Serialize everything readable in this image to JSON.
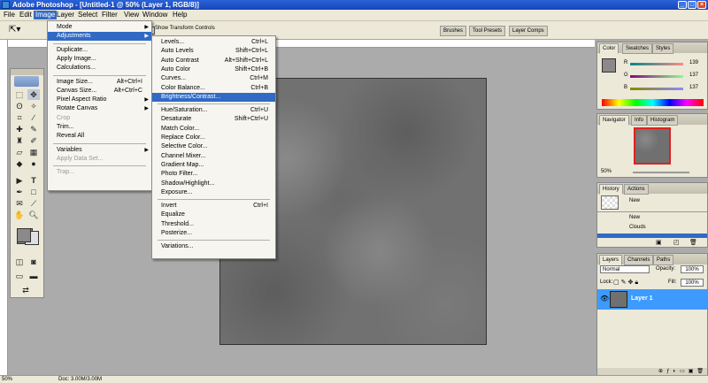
{
  "window": {
    "title": "Adobe Photoshop - [Untitled-1 @ 50% (Layer 1, RGB/8)]"
  },
  "menubar": [
    "File",
    "Edit",
    "Image",
    "Layer",
    "Select",
    "Filter",
    "View",
    "Window",
    "Help"
  ],
  "options_bar": {
    "show_transform_controls": "Show Transform Controls"
  },
  "palette_well": [
    "Brushes",
    "Tool Presets",
    "Layer Comps"
  ],
  "image_menu": [
    {
      "label": "Mode",
      "arrow": true
    },
    {
      "label": "Adjustments",
      "arrow": true,
      "highlight": true
    },
    {
      "sep": true
    },
    {
      "label": "Duplicate..."
    },
    {
      "label": "Apply Image..."
    },
    {
      "label": "Calculations..."
    },
    {
      "sep": true
    },
    {
      "label": "Image Size...",
      "shortcut": "Alt+Ctrl+I"
    },
    {
      "label": "Canvas Size...",
      "shortcut": "Alt+Ctrl+C"
    },
    {
      "label": "Pixel Aspect Ratio",
      "arrow": true
    },
    {
      "label": "Rotate Canvas",
      "arrow": true
    },
    {
      "label": "Crop",
      "disabled": true
    },
    {
      "label": "Trim..."
    },
    {
      "label": "Reveal All"
    },
    {
      "sep": true
    },
    {
      "label": "Variables",
      "arrow": true
    },
    {
      "label": "Apply Data Set...",
      "disabled": true
    },
    {
      "sep": true
    },
    {
      "label": "Trap...",
      "disabled": true
    }
  ],
  "adjustments_menu": [
    {
      "label": "Levels...",
      "shortcut": "Ctrl+L"
    },
    {
      "label": "Auto Levels",
      "shortcut": "Shift+Ctrl+L"
    },
    {
      "label": "Auto Contrast",
      "shortcut": "Alt+Shift+Ctrl+L"
    },
    {
      "label": "Auto Color",
      "shortcut": "Shift+Ctrl+B"
    },
    {
      "label": "Curves...",
      "shortcut": "Ctrl+M"
    },
    {
      "label": "Color Balance...",
      "shortcut": "Ctrl+B"
    },
    {
      "label": "Brightness/Contrast...",
      "highlight": true
    },
    {
      "sep": true
    },
    {
      "label": "Hue/Saturation...",
      "shortcut": "Ctrl+U"
    },
    {
      "label": "Desaturate",
      "shortcut": "Shift+Ctrl+U"
    },
    {
      "label": "Match Color..."
    },
    {
      "label": "Replace Color..."
    },
    {
      "label": "Selective Color..."
    },
    {
      "label": "Channel Mixer..."
    },
    {
      "label": "Gradient Map..."
    },
    {
      "label": "Photo Filter..."
    },
    {
      "label": "Shadow/Highlight..."
    },
    {
      "label": "Exposure..."
    },
    {
      "sep": true
    },
    {
      "label": "Invert",
      "shortcut": "Ctrl+I"
    },
    {
      "label": "Equalize"
    },
    {
      "label": "Threshold..."
    },
    {
      "label": "Posterize..."
    },
    {
      "sep": true
    },
    {
      "label": "Variations..."
    }
  ],
  "color_panel": {
    "tabs": [
      "Color",
      "Swatches",
      "Styles"
    ],
    "channels": [
      {
        "name": "R",
        "value": "139"
      },
      {
        "name": "G",
        "value": "137"
      },
      {
        "name": "B",
        "value": "137"
      }
    ]
  },
  "navigator_panel": {
    "tabs": [
      "Navigator",
      "Info",
      "Histogram"
    ],
    "zoom": "50%"
  },
  "history_panel": {
    "tabs": [
      "History",
      "Actions"
    ],
    "snapshot": "New",
    "states": [
      "New",
      "Clouds"
    ]
  },
  "layers_panel": {
    "tabs": [
      "Layers",
      "Channels",
      "Paths"
    ],
    "blend_mode": "Normal",
    "opacity_label": "Opacity:",
    "opacity": "100%",
    "lock_label": "Lock:",
    "fill_label": "Fill:",
    "fill": "100%",
    "layers": [
      {
        "name": "Layer 1",
        "selected": true
      }
    ]
  },
  "statusbar": {
    "zoom": "50%",
    "doc": "Doc: 3.00M/3.00M"
  }
}
